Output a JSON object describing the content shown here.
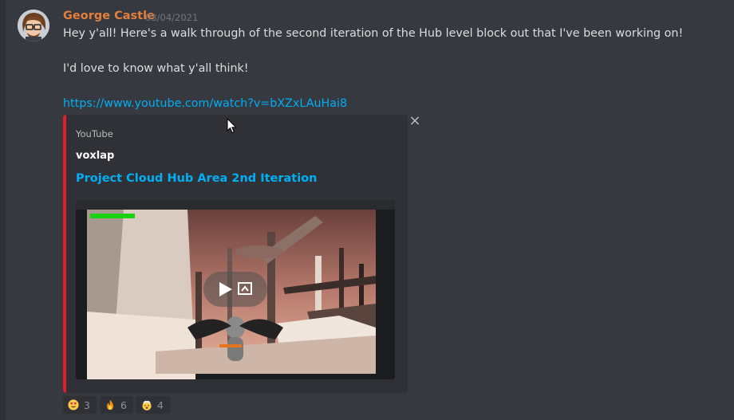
{
  "message": {
    "username": "George Castle",
    "timestamp": "03/04/2021",
    "lines": [
      "Hey y'all! Here's a walk through of the second iteration of the Hub level block out that I've been working on!",
      "I'd love to know what y'all think!"
    ],
    "link": "https://www.youtube.com/watch?v=bXZxLAuHai8"
  },
  "embed": {
    "provider": "YouTube",
    "author": "voxlap",
    "title": "Project Cloud Hub Area 2nd Iteration",
    "accent_color": "#e3202a",
    "close_icon": "×"
  },
  "reactions": [
    {
      "emoji": "heart-eyes-emoji",
      "count": "3"
    },
    {
      "emoji": "fire-emoji",
      "count": "6"
    },
    {
      "emoji": "exploding-head-emoji",
      "count": "4"
    }
  ],
  "colors": {
    "background": "#36393f",
    "username": "#e67e3b",
    "link": "#00aff4",
    "embed_background": "#2f3136"
  }
}
